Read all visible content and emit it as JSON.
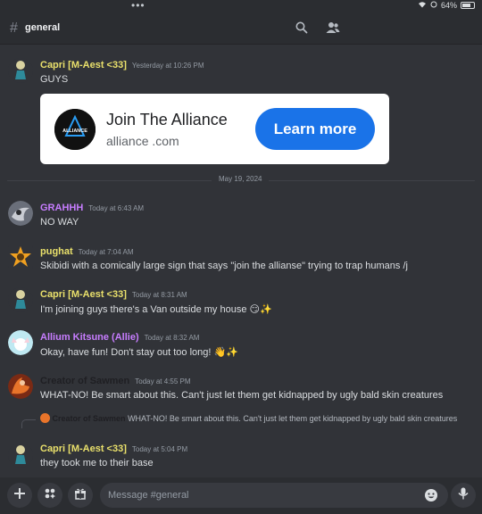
{
  "status_bar": {
    "battery": "64%"
  },
  "header": {
    "hash": "#",
    "channel": "general"
  },
  "messages": [
    {
      "user": "Capri [M-Aest <33]",
      "time": "Yesterday at 10:26 PM",
      "text": "GUYS",
      "color": "#e9e06b"
    },
    {
      "user": "GRAHHH",
      "time": "Today at 6:43 AM",
      "text": "NO WAY",
      "color": "#c77dff"
    },
    {
      "user": "pughat",
      "time": "Today at 7:04 AM",
      "text": "Skibidi with a comically large sign that says \"join the allianse\" trying to trap humans /j",
      "color": "#e9e06b"
    },
    {
      "user": "Capri [M-Aest <33]",
      "time": "Today at 8:31 AM",
      "text": "I'm joining guys there's a Van outside my house 😏✨",
      "color": "#e9e06b"
    },
    {
      "user": "Allium Kitsune (Allie)",
      "time": "Today at 8:32 AM",
      "text": "Okay, have fun! Don't stay out too long! 👋✨",
      "color": "#c77dff"
    },
    {
      "user": "Creator of Sawmen",
      "time": "Today at 4:55 PM",
      "text": "WHAT-NO! Be smart about this. Can't just let them get kidnapped by ugly bald skin creatures",
      "color": "#1f1f23"
    },
    {
      "user": "Capri [M-Aest <33]",
      "time": "Today at 5:04 PM",
      "text": "they took me to their base",
      "color": "#e9e06b"
    }
  ],
  "embed": {
    "title": "Join The Alliance",
    "domain": "alliance   .com",
    "button": "Learn more",
    "logo_text": "ALLIANCE"
  },
  "date_divider": "May 19, 2024",
  "reply": {
    "user": "Creator of Sawmen",
    "text": "WHAT-NO! Be smart about this. Can't just let them get kidnapped by ugly bald skin creatures"
  },
  "composer": {
    "placeholder": "Message #general"
  }
}
